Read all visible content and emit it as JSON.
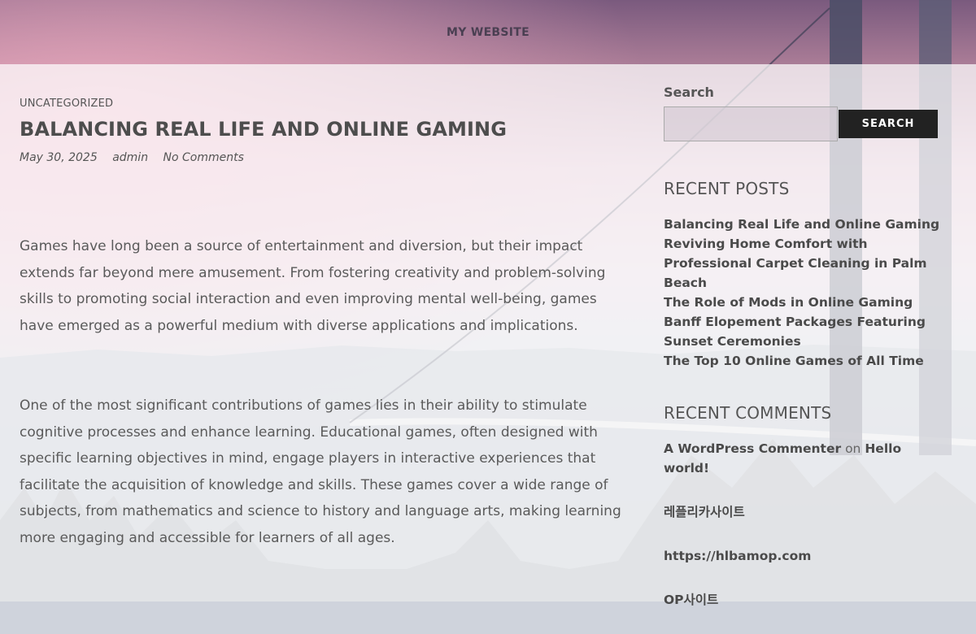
{
  "site": {
    "title": "MY WEBSITE"
  },
  "post": {
    "category": "UNCATEGORIZED",
    "title": "BALANCING REAL LIFE AND ONLINE GAMING",
    "date": "May 30, 2025",
    "author": "admin",
    "comments": "No Comments",
    "paragraphs": [
      "Games have long been a source of entertainment and diversion, but their impact extends far beyond mere amusement. From fostering creativity and problem-solving skills to promoting social interaction and even improving mental well-being, games have emerged as a powerful medium with diverse applications and implications.",
      "One of the most significant contributions of games lies in their ability to stimulate cognitive processes and enhance learning. Educational games, often designed with specific learning objectives in mind, engage players in interactive experiences that facilitate the acquisition of knowledge and skills. These games cover a wide range of subjects, from mathematics and science to history and language arts, making learning more engaging and accessible for learners of all ages."
    ]
  },
  "sidebar": {
    "search": {
      "label": "Search",
      "button": "SEARCH",
      "value": ""
    },
    "recent_posts": {
      "title": "RECENT POSTS",
      "items": [
        "Balancing Real Life and Online Gaming",
        "Reviving Home Comfort with Professional Carpet Cleaning in Palm Beach",
        "The Role of Mods in Online Gaming",
        "Banff Elopement Packages Featuring Sunset Ceremonies",
        "The Top 10 Online Games of All Time"
      ]
    },
    "recent_comments": {
      "title": "RECENT COMMENTS",
      "items": [
        {
          "author": "A WordPress Commenter",
          "on": "on",
          "post": "Hello world!"
        },
        {
          "author": "레플리카사이트"
        },
        {
          "author": "https://hlbamop.com"
        },
        {
          "author": "OP사이트"
        }
      ]
    }
  }
}
